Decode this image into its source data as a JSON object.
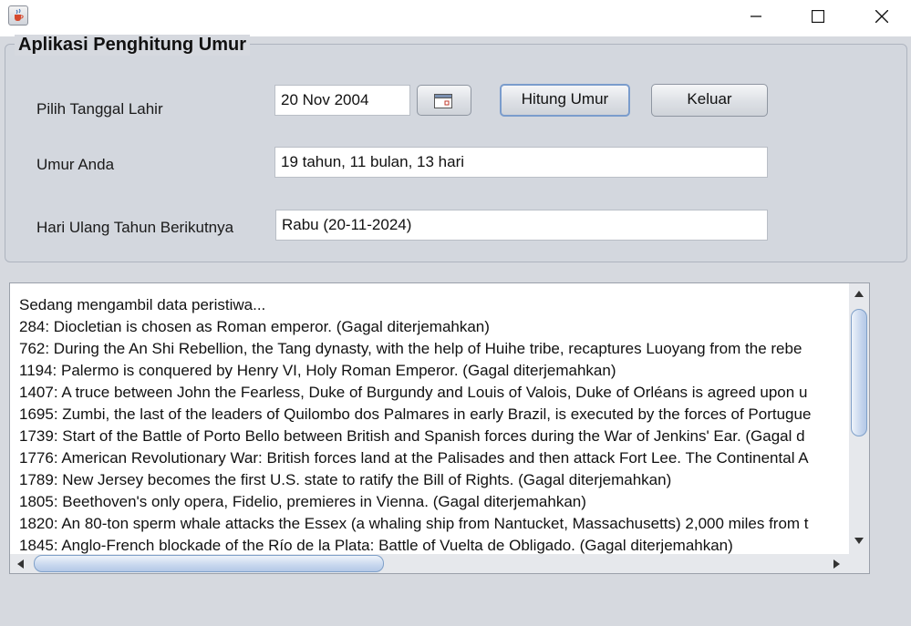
{
  "window": {
    "icons": {
      "app": "java-cup-icon",
      "minimize": "minimize-icon",
      "maximize": "maximize-icon",
      "close": "close-icon"
    }
  },
  "form": {
    "group_title": "Aplikasi Penghitung Umur",
    "birthdate_label": "Pilih Tanggal Lahir",
    "birthdate_value": "20 Nov 2004",
    "calendar_icon": "calendar-icon",
    "calculate_label": "Hitung Umur",
    "exit_label": "Keluar",
    "age_label": "Umur Anda",
    "age_value": "19 tahun, 11 bulan, 13 hari",
    "next_birthday_label": "Hari Ulang Tahun Berikutnya",
    "next_birthday_value": "Rabu (20-11-2024)"
  },
  "events": {
    "lines": [
      "Sedang mengambil data peristiwa...",
      "284: Diocletian is chosen as Roman emperor. (Gagal diterjemahkan)",
      "762: During the An Shi Rebellion, the Tang dynasty, with the help of Huihe tribe, recaptures Luoyang from the rebe",
      "1194: Palermo is conquered by Henry VI, Holy Roman Emperor. (Gagal diterjemahkan)",
      "1407: A truce between John the Fearless, Duke of Burgundy and Louis of Valois, Duke of Orléans is agreed upon u",
      "1695: Zumbi, the last of the leaders of Quilombo dos Palmares in early Brazil, is executed by the forces of Portugue",
      "1739: Start of the Battle of Porto Bello between British and Spanish forces during the War of Jenkins' Ear. (Gagal d",
      "1776: American Revolutionary War: British forces land at the Palisades and then attack Fort Lee. The Continental A",
      "1789: New Jersey becomes the first U.S. state to ratify the Bill of Rights. (Gagal diterjemahkan)",
      "1805: Beethoven's only opera, Fidelio, premieres in Vienna. (Gagal diterjemahkan)",
      "1820: An 80-ton sperm whale attacks the Essex (a whaling ship from Nantucket, Massachusetts) 2,000 miles from t",
      "1845: Anglo-French blockade of the Río de la Plata: Battle of Vuelta de Obligado. (Gagal diterjemahkan)"
    ]
  }
}
